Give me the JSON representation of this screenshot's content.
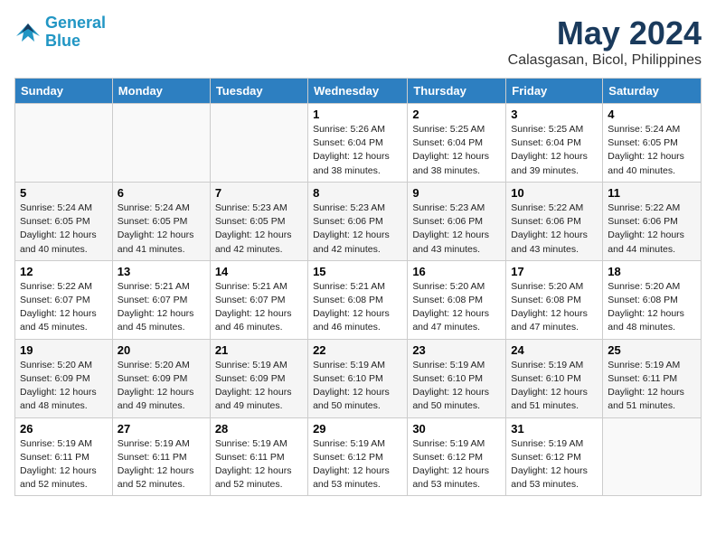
{
  "header": {
    "logo_line1": "General",
    "logo_line2": "Blue",
    "month": "May 2024",
    "location": "Calasgasan, Bicol, Philippines"
  },
  "weekdays": [
    "Sunday",
    "Monday",
    "Tuesday",
    "Wednesday",
    "Thursday",
    "Friday",
    "Saturday"
  ],
  "weeks": [
    [
      {
        "day": "",
        "info": ""
      },
      {
        "day": "",
        "info": ""
      },
      {
        "day": "",
        "info": ""
      },
      {
        "day": "1",
        "info": "Sunrise: 5:26 AM\nSunset: 6:04 PM\nDaylight: 12 hours\nand 38 minutes."
      },
      {
        "day": "2",
        "info": "Sunrise: 5:25 AM\nSunset: 6:04 PM\nDaylight: 12 hours\nand 38 minutes."
      },
      {
        "day": "3",
        "info": "Sunrise: 5:25 AM\nSunset: 6:04 PM\nDaylight: 12 hours\nand 39 minutes."
      },
      {
        "day": "4",
        "info": "Sunrise: 5:24 AM\nSunset: 6:05 PM\nDaylight: 12 hours\nand 40 minutes."
      }
    ],
    [
      {
        "day": "5",
        "info": "Sunrise: 5:24 AM\nSunset: 6:05 PM\nDaylight: 12 hours\nand 40 minutes."
      },
      {
        "day": "6",
        "info": "Sunrise: 5:24 AM\nSunset: 6:05 PM\nDaylight: 12 hours\nand 41 minutes."
      },
      {
        "day": "7",
        "info": "Sunrise: 5:23 AM\nSunset: 6:05 PM\nDaylight: 12 hours\nand 42 minutes."
      },
      {
        "day": "8",
        "info": "Sunrise: 5:23 AM\nSunset: 6:06 PM\nDaylight: 12 hours\nand 42 minutes."
      },
      {
        "day": "9",
        "info": "Sunrise: 5:23 AM\nSunset: 6:06 PM\nDaylight: 12 hours\nand 43 minutes."
      },
      {
        "day": "10",
        "info": "Sunrise: 5:22 AM\nSunset: 6:06 PM\nDaylight: 12 hours\nand 43 minutes."
      },
      {
        "day": "11",
        "info": "Sunrise: 5:22 AM\nSunset: 6:06 PM\nDaylight: 12 hours\nand 44 minutes."
      }
    ],
    [
      {
        "day": "12",
        "info": "Sunrise: 5:22 AM\nSunset: 6:07 PM\nDaylight: 12 hours\nand 45 minutes."
      },
      {
        "day": "13",
        "info": "Sunrise: 5:21 AM\nSunset: 6:07 PM\nDaylight: 12 hours\nand 45 minutes."
      },
      {
        "day": "14",
        "info": "Sunrise: 5:21 AM\nSunset: 6:07 PM\nDaylight: 12 hours\nand 46 minutes."
      },
      {
        "day": "15",
        "info": "Sunrise: 5:21 AM\nSunset: 6:08 PM\nDaylight: 12 hours\nand 46 minutes."
      },
      {
        "day": "16",
        "info": "Sunrise: 5:20 AM\nSunset: 6:08 PM\nDaylight: 12 hours\nand 47 minutes."
      },
      {
        "day": "17",
        "info": "Sunrise: 5:20 AM\nSunset: 6:08 PM\nDaylight: 12 hours\nand 47 minutes."
      },
      {
        "day": "18",
        "info": "Sunrise: 5:20 AM\nSunset: 6:08 PM\nDaylight: 12 hours\nand 48 minutes."
      }
    ],
    [
      {
        "day": "19",
        "info": "Sunrise: 5:20 AM\nSunset: 6:09 PM\nDaylight: 12 hours\nand 48 minutes."
      },
      {
        "day": "20",
        "info": "Sunrise: 5:20 AM\nSunset: 6:09 PM\nDaylight: 12 hours\nand 49 minutes."
      },
      {
        "day": "21",
        "info": "Sunrise: 5:19 AM\nSunset: 6:09 PM\nDaylight: 12 hours\nand 49 minutes."
      },
      {
        "day": "22",
        "info": "Sunrise: 5:19 AM\nSunset: 6:10 PM\nDaylight: 12 hours\nand 50 minutes."
      },
      {
        "day": "23",
        "info": "Sunrise: 5:19 AM\nSunset: 6:10 PM\nDaylight: 12 hours\nand 50 minutes."
      },
      {
        "day": "24",
        "info": "Sunrise: 5:19 AM\nSunset: 6:10 PM\nDaylight: 12 hours\nand 51 minutes."
      },
      {
        "day": "25",
        "info": "Sunrise: 5:19 AM\nSunset: 6:11 PM\nDaylight: 12 hours\nand 51 minutes."
      }
    ],
    [
      {
        "day": "26",
        "info": "Sunrise: 5:19 AM\nSunset: 6:11 PM\nDaylight: 12 hours\nand 52 minutes."
      },
      {
        "day": "27",
        "info": "Sunrise: 5:19 AM\nSunset: 6:11 PM\nDaylight: 12 hours\nand 52 minutes."
      },
      {
        "day": "28",
        "info": "Sunrise: 5:19 AM\nSunset: 6:11 PM\nDaylight: 12 hours\nand 52 minutes."
      },
      {
        "day": "29",
        "info": "Sunrise: 5:19 AM\nSunset: 6:12 PM\nDaylight: 12 hours\nand 53 minutes."
      },
      {
        "day": "30",
        "info": "Sunrise: 5:19 AM\nSunset: 6:12 PM\nDaylight: 12 hours\nand 53 minutes."
      },
      {
        "day": "31",
        "info": "Sunrise: 5:19 AM\nSunset: 6:12 PM\nDaylight: 12 hours\nand 53 minutes."
      },
      {
        "day": "",
        "info": ""
      }
    ]
  ]
}
